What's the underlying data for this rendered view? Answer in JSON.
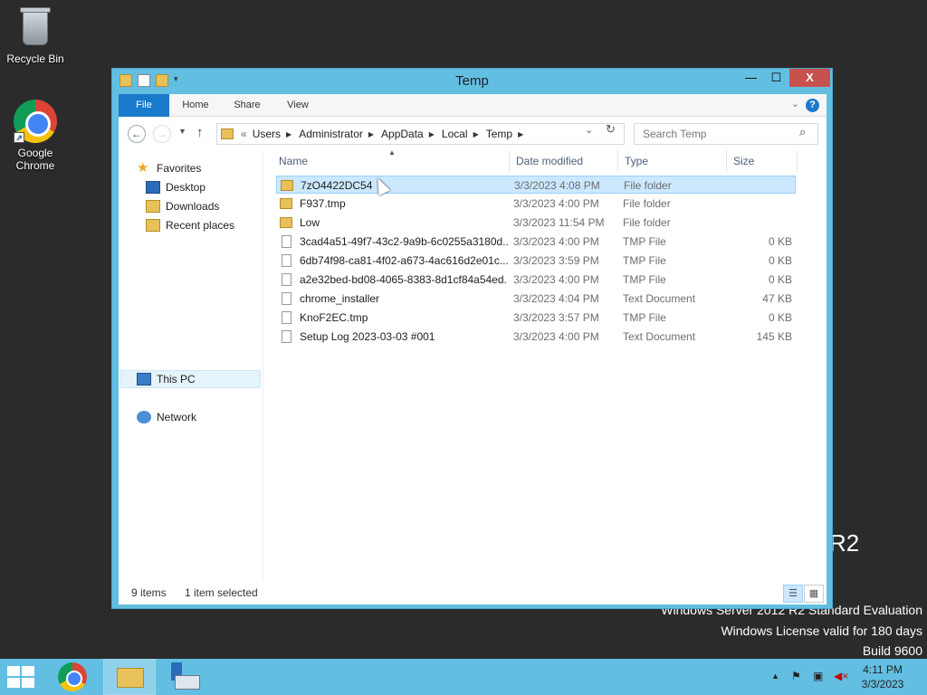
{
  "desktop": {
    "icons": [
      {
        "label": "Recycle Bin"
      },
      {
        "label_line1": "Google",
        "label_line2": "Chrome"
      }
    ],
    "watermark": {
      "r2": "R2",
      "line1": "Windows Server 2012 R2 Standard Evaluation",
      "line2": "Windows License valid for 180 days",
      "line3": "Build 9600"
    }
  },
  "window": {
    "title": "Temp",
    "controls": {
      "minimize": "—",
      "maximize": "☐",
      "close": "X"
    },
    "ribbon": {
      "tabs": [
        "File",
        "Home",
        "Share",
        "View"
      ],
      "help": "?"
    },
    "address": {
      "overflow": "«",
      "crumbs": [
        "Users",
        "Administrator",
        "AppData",
        "Local",
        "Temp"
      ]
    },
    "search": {
      "placeholder": "Search Temp"
    },
    "nav": {
      "favorites": "Favorites",
      "desktop": "Desktop",
      "downloads": "Downloads",
      "recent": "Recent places",
      "this_pc": "This PC",
      "network": "Network"
    },
    "columns": {
      "name": "Name",
      "date": "Date modified",
      "type": "Type",
      "size": "Size"
    },
    "files": [
      {
        "name": "7zO4422DC54",
        "date": "3/3/2023 4:08 PM",
        "type": "File folder",
        "size": "",
        "kind": "folder",
        "selected": true
      },
      {
        "name": "F937.tmp",
        "date": "3/3/2023 4:00 PM",
        "type": "File folder",
        "size": "",
        "kind": "folder"
      },
      {
        "name": "Low",
        "date": "3/3/2023 11:54 PM",
        "type": "File folder",
        "size": "",
        "kind": "folder"
      },
      {
        "name": "3cad4a51-49f7-43c2-9a9b-6c0255a3180d....",
        "date": "3/3/2023 4:00 PM",
        "type": "TMP File",
        "size": "0 KB",
        "kind": "file"
      },
      {
        "name": "6db74f98-ca81-4f02-a673-4ac616d2e01c....",
        "date": "3/3/2023 3:59 PM",
        "type": "TMP File",
        "size": "0 KB",
        "kind": "file"
      },
      {
        "name": "a2e32bed-bd08-4065-8383-8d1cf84a54ed....",
        "date": "3/3/2023 4:00 PM",
        "type": "TMP File",
        "size": "0 KB",
        "kind": "file"
      },
      {
        "name": "chrome_installer",
        "date": "3/3/2023 4:04 PM",
        "type": "Text Document",
        "size": "47 KB",
        "kind": "file"
      },
      {
        "name": "KnoF2EC.tmp",
        "date": "3/3/2023 3:57 PM",
        "type": "TMP File",
        "size": "0 KB",
        "kind": "file"
      },
      {
        "name": "Setup Log 2023-03-03 #001",
        "date": "3/3/2023 4:00 PM",
        "type": "Text Document",
        "size": "145 KB",
        "kind": "file"
      }
    ],
    "status": {
      "items": "9 items",
      "selected": "1 item selected"
    }
  },
  "taskbar": {
    "clock_time": "4:11 PM",
    "clock_date": "3/3/2023"
  },
  "colors": {
    "accent": "#62bfe2",
    "selection": "#cce8ff",
    "close": "#c7514c",
    "file_tab": "#1979ca"
  }
}
